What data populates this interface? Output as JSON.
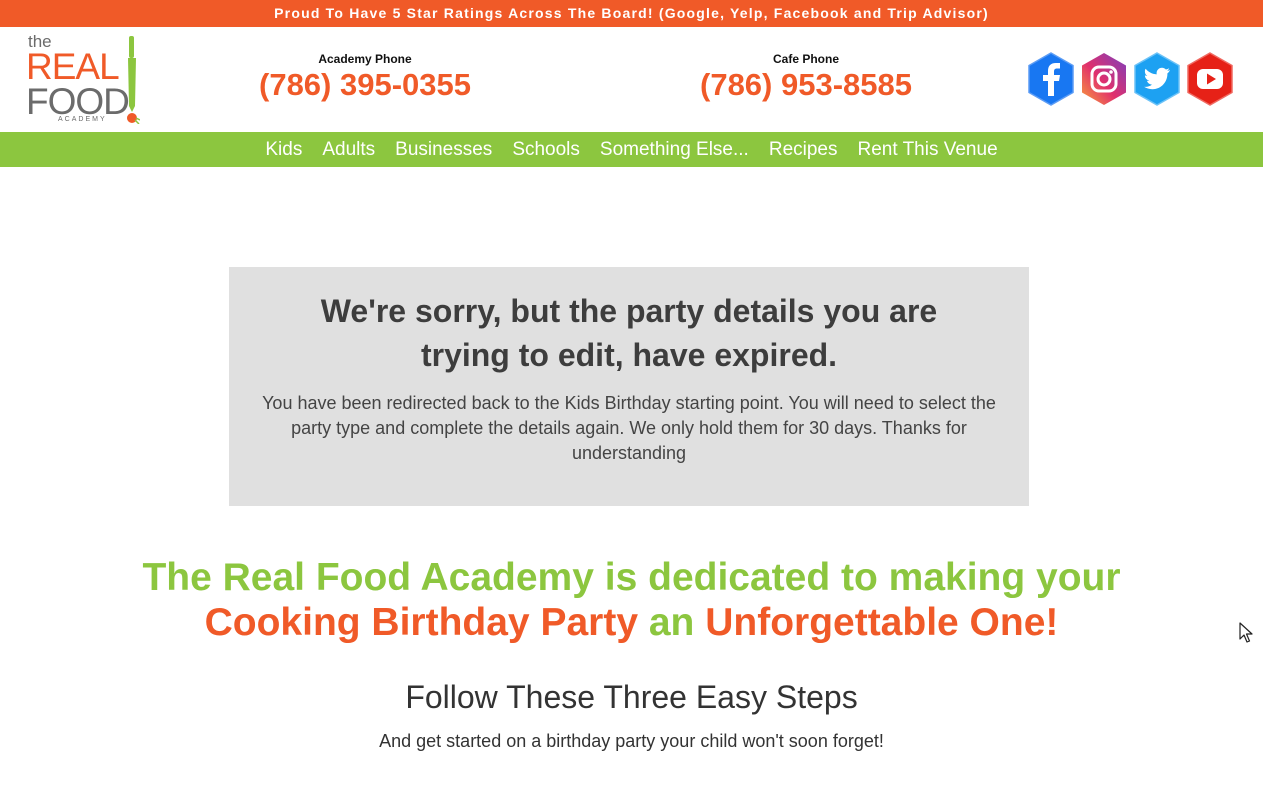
{
  "topbar": {
    "text": "Proud To Have 5 Star Ratings Across The Board! (Google, Yelp, Facebook and Trip Advisor)"
  },
  "logo": {
    "the": "the",
    "real": "REAL",
    "food": "FOOD",
    "academy": "ACADEMY"
  },
  "phones": {
    "academy_label": "Academy Phone",
    "academy_number": "(786) 395-0355",
    "cafe_label": "Cafe Phone",
    "cafe_number": "(786) 953-8585"
  },
  "socials": [
    {
      "name": "facebook-icon",
      "color": "#1877f2"
    },
    {
      "name": "instagram-icon",
      "color": "#c13584"
    },
    {
      "name": "twitter-icon",
      "color": "#1da1f2"
    },
    {
      "name": "youtube-icon",
      "color": "#e62117"
    }
  ],
  "nav": {
    "items": [
      "Kids",
      "Adults",
      "Businesses",
      "Schools",
      "Something Else...",
      "Recipes",
      "Rent This Venue"
    ]
  },
  "notice": {
    "title": "We're sorry, but the party details you are trying to edit, have expired.",
    "body": "You have been redirected back to the Kids Birthday starting point. You will need to select the party type and complete the details again. We only hold them for 30 days. Thanks for understanding"
  },
  "headline": {
    "part1": "The Real Food Academy is dedicated to making your",
    "part2": "Cooking Birthday Party",
    "part3": "an",
    "part4": "Unforgettable One!"
  },
  "steps": {
    "title": "Follow These Three Easy Steps",
    "subtitle": "And get started on a birthday party your child won't soon forget!"
  },
  "colors": {
    "brand_orange": "#f05a28",
    "brand_green": "#8cc63f"
  }
}
